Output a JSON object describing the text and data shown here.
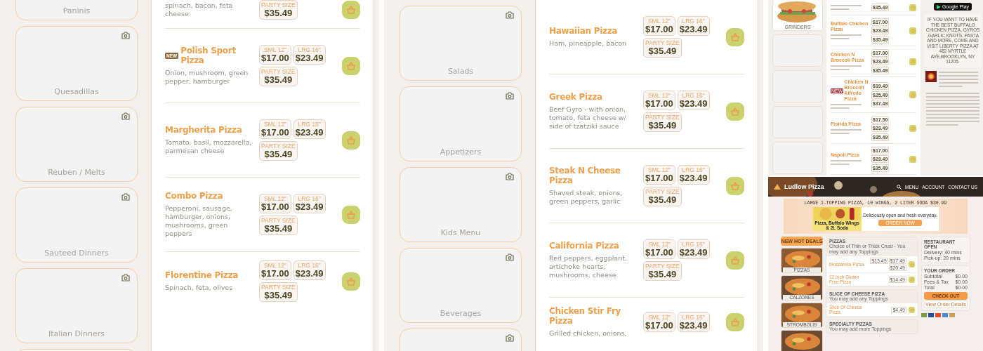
{
  "menu_pages": [
    {
      "categories": [
        {
          "kind": "category",
          "label": "Paninis"
        },
        {
          "kind": "category",
          "label": "Quesadillas"
        },
        {
          "kind": "category",
          "label": "Reuben / Melts"
        },
        {
          "kind": "category",
          "label": "Sauteed Dinners"
        },
        {
          "kind": "category",
          "label": "Italian Dinners"
        },
        {
          "kind": "edge"
        }
      ],
      "items": [
        {
          "description": "spinach, bacon, feta cheese",
          "prices": [
            {
              "label": "PARTY SIZE",
              "amount": "$35.49"
            }
          ]
        },
        {
          "badge": "NEW",
          "name": "Polish Sport Pizza",
          "description": "Onion, mushroom, green pepper, hamburger",
          "prices": [
            {
              "label": "SML 12\"",
              "amount": "$17.00"
            },
            {
              "label": "LRG 16\"",
              "amount": "$23.49"
            },
            {
              "label": "PARTY SIZE",
              "amount": "$35.49"
            }
          ]
        },
        {
          "name": "Margherita Pizza",
          "description": "Tomato, basil, mozzarella, parmesan cheese",
          "prices": [
            {
              "label": "SML 12\"",
              "amount": "$17.00"
            },
            {
              "label": "LRG 16\"",
              "amount": "$23.49"
            },
            {
              "label": "PARTY SIZE",
              "amount": "$35.49"
            }
          ]
        },
        {
          "name": "Combo Pizza",
          "description": "Pepperoni, sausage, hamburger, onions, mushrooms, green peppers",
          "prices": [
            {
              "label": "SML 12\"",
              "amount": "$17.00"
            },
            {
              "label": "LRG 16\"",
              "amount": "$23.49"
            },
            {
              "label": "PARTY SIZE",
              "amount": "$35.49"
            }
          ]
        },
        {
          "name": "Florentine Pizza",
          "description": "Spinach, feta, olives",
          "prices": [
            {
              "label": "SML 12\"",
              "amount": "$17.00"
            },
            {
              "label": "LRG 16\"",
              "amount": "$23.49"
            },
            {
              "label": "PARTY SIZE",
              "amount": "$35.49"
            }
          ]
        }
      ]
    },
    {
      "categories": [
        {
          "kind": "category",
          "label": "Salads"
        },
        {
          "kind": "category",
          "label": "Appetizers"
        },
        {
          "kind": "category",
          "label": "Kids Menu"
        },
        {
          "kind": "category",
          "label": "Beverages"
        },
        {
          "kind": "blank"
        }
      ],
      "items": [
        {
          "name": "Hawaiian Pizza",
          "description": "Ham, pineapple, bacon",
          "prices": [
            {
              "label": "SML 12\"",
              "amount": "$17.00"
            },
            {
              "label": "LRG 16\"",
              "amount": "$23.49"
            },
            {
              "label": "PARTY SIZE",
              "amount": "$35.49"
            }
          ]
        },
        {
          "name": "Greek Pizza",
          "description": "Beef Gyro - with onion, tomato, feta cheese w/ side of tzatziki sauce",
          "prices": [
            {
              "label": "SML 12\"",
              "amount": "$17.00"
            },
            {
              "label": "LRG 16\"",
              "amount": "$23.49"
            },
            {
              "label": "PARTY SIZE",
              "amount": "$35.49"
            }
          ]
        },
        {
          "name": "Steak N Cheese Pizza",
          "description": "Shaved steak, onions, green peppers, garlic",
          "prices": [
            {
              "label": "SML 12\"",
              "amount": "$17.00"
            },
            {
              "label": "LRG 16\"",
              "amount": "$23.49"
            },
            {
              "label": "PARTY SIZE",
              "amount": "$35.49"
            }
          ]
        },
        {
          "name": "California Pizza",
          "description": "Red peppers, eggplant, artichoke hearts, mushrooms, cheese",
          "prices": [
            {
              "label": "SML 12\"",
              "amount": "$17.00"
            },
            {
              "label": "LRG 16\"",
              "amount": "$23.49"
            },
            {
              "label": "PARTY SIZE",
              "amount": "$35.49"
            }
          ]
        },
        {
          "name": "Chicken Stir Fry Pizza",
          "description": "Grilled chicken, onions,",
          "prices": [
            {
              "label": "SML 12\"",
              "amount": "$17.00"
            },
            {
              "label": "LRG 16\"",
              "amount": "$23.49"
            }
          ]
        }
      ]
    }
  ],
  "thumb": {
    "cards": [
      {
        "kind": "picture",
        "label": "GRINDERS"
      },
      {
        "kind": "blank"
      },
      {
        "kind": "blank"
      },
      {
        "kind": "blank"
      },
      {
        "kind": "blank"
      }
    ],
    "items": [
      {
        "prices": [
          {
            "amount": "$35.49"
          }
        ]
      },
      {
        "name": "Buffalo Chicken Pizza",
        "prices": [
          {
            "amount": "$17.00"
          },
          {
            "amount": "$23.49"
          },
          {
            "amount": "$35.49"
          }
        ]
      },
      {
        "name": "Chicken N Broccoli Pizza",
        "prices": [
          {
            "amount": "$17.00"
          },
          {
            "amount": "$23.49"
          },
          {
            "amount": "$35.49"
          }
        ]
      },
      {
        "badge": "NEW",
        "name": "Chicken N Broccoli Alfredo Pizza",
        "prices": [
          {
            "amount": "$19.49"
          },
          {
            "amount": "$25.49"
          },
          {
            "amount": "$37.49"
          }
        ]
      },
      {
        "name": "Florida Pizza",
        "prices": [
          {
            "amount": "$17.50"
          },
          {
            "amount": "$23.49"
          },
          {
            "amount": "$35.49"
          }
        ]
      },
      {
        "name": "Napoli Pizza",
        "prices": [
          {
            "amount": "$17.00"
          },
          {
            "amount": "$23.49"
          },
          {
            "amount": "$35.49"
          }
        ]
      }
    ],
    "store_badge": "Google Play",
    "promo_text": "IF YOU WANT TO HAVE THE BEST BUFFALO CHICKEN PIZZA, GYROS ,GARLIC KNOTS, PASTA AND MORE, COME AND VISIT LIBERTY PIZZA AT 482 MYRTLE AVE,BROOKLYN, NY 11205."
  },
  "site": {
    "brand": "Ludlow Pizza",
    "nav": [
      "MENU",
      "ACCOUNT",
      "CONTACT US"
    ],
    "promo": {
      "headline": "LARGE 1-TOPPING PIZZA, 10 WINGS, 2 LITER SODA $30.99",
      "caption": "Pizza, Buffalo Wings & 2L Soda",
      "tagline": "Deliciously open and fresh everyday.",
      "button": "ORDER NOW"
    },
    "deals": {
      "title": "NEW HOT DEALS",
      "cards": [
        {
          "kind": "picture",
          "label": "PIZZAS"
        },
        {
          "kind": "picture",
          "label": "CALZONES"
        },
        {
          "kind": "picture",
          "label": "STROMBOLIS"
        },
        {
          "kind": "picture"
        }
      ]
    },
    "sections": [
      {
        "title": "PIZZAS",
        "subtitle": "Choice of Thin or Thick Crust - You may add any Toppings",
        "items": [
          {
            "name": "Mozzarella Pizza",
            "prices": [
              {
                "amount": "$13.49"
              },
              {
                "amount": "$17.49"
              },
              {
                "amount": "$20.49"
              }
            ]
          },
          {
            "name": "12 Inch Gluten Free Pizza",
            "prices": [
              {
                "amount": "$14.49"
              }
            ]
          }
        ]
      },
      {
        "title": "SLICE OF CHEESE PIZZA",
        "subtitle": "You may add any Toppings",
        "items": [
          {
            "name": "Slice Of Cheese Pizza",
            "prices": [
              {
                "amount": "$4.49"
              }
            ]
          }
        ]
      },
      {
        "title": "SPECIALTY PIZZAS",
        "subtitle": "You may add more Toppings"
      }
    ],
    "status": {
      "title": "RESTAURANT OPEN",
      "lines": [
        "Delivery: 40 mins",
        "Pick-up: 20 mins"
      ]
    },
    "order": {
      "title": "YOUR ORDER",
      "rows": [
        {
          "label": "Subtotal",
          "value": "$0.00"
        },
        {
          "label": "Fees & Tax",
          "value": "$0.00"
        },
        {
          "label": "Total",
          "value": "$0.00"
        }
      ],
      "checkout": "CHECK OUT",
      "details": "View Order Details"
    }
  }
}
